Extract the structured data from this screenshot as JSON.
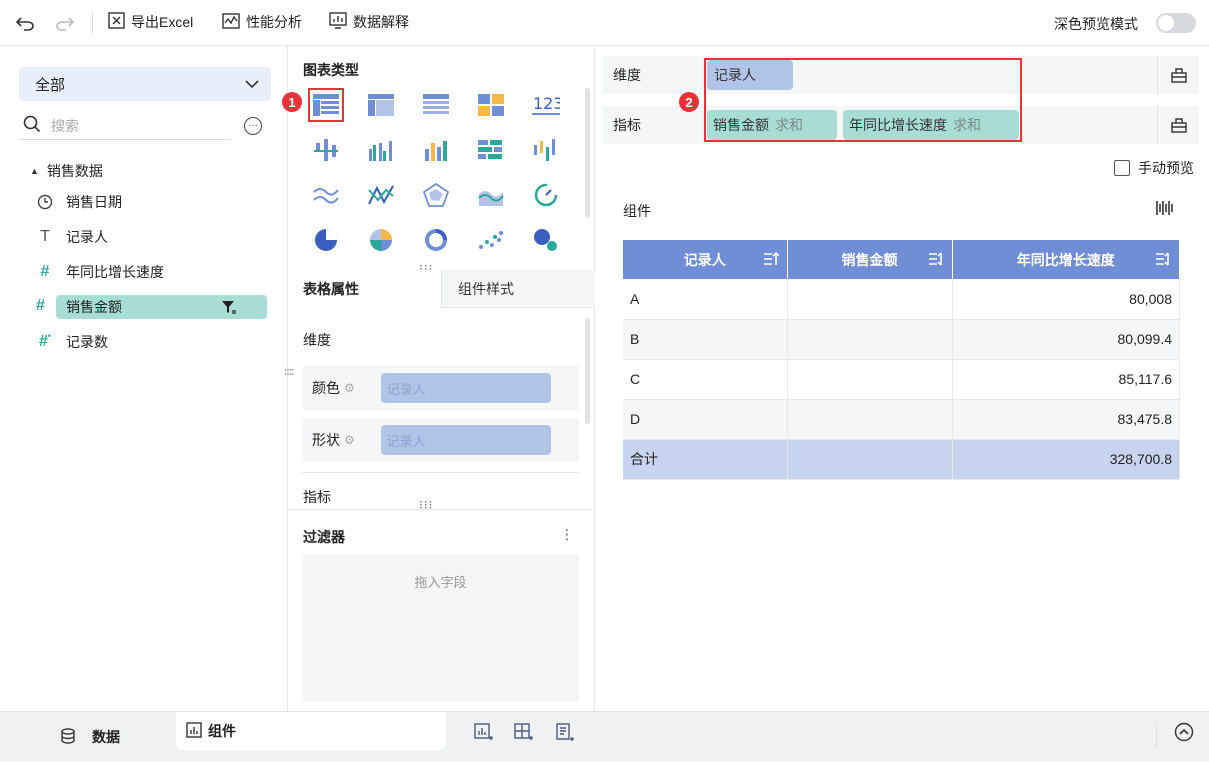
{
  "toolbar": {
    "export_label": "导出Excel",
    "perf_label": "性能分析",
    "explain_label": "数据解释",
    "dark_mode_label": "深色预览模式"
  },
  "left": {
    "select_value": "全部",
    "search_placeholder": "搜索",
    "dataset": "销售数据",
    "fields": [
      {
        "label": "销售日期",
        "icon": "clock-icon"
      },
      {
        "label": "记录人",
        "icon": "text-T-icon"
      },
      {
        "label": "年同比增长速度",
        "icon": "hash-icon"
      },
      {
        "label": "销售金额",
        "icon": "hash-icon"
      },
      {
        "label": "记录数",
        "icon": "hash-count-icon"
      }
    ]
  },
  "mid": {
    "chart_type_title": "图表类型",
    "tab_table_attr": "表格属性",
    "tab_component_style": "组件样式",
    "dimension_label": "维度",
    "color_label": "颜色",
    "color_value": "记录人",
    "shape_label": "形状",
    "shape_value": "记录人",
    "metric_label": "指标",
    "filter_title": "过滤器",
    "filter_drop_hint": "拖入字段"
  },
  "right": {
    "dimension_label": "维度",
    "dimension_pill": "记录人",
    "metric_label": "指标",
    "metric_pill_1": "销售金额",
    "metric_pill_1_agg": "求和",
    "metric_pill_2": "年同比增长速度",
    "metric_pill_2_agg": "求和",
    "manual_preview": "手动预览",
    "component_title": "组件",
    "badge_1": "1",
    "badge_2": "2"
  },
  "table": {
    "headers": [
      "记录人",
      "销售金额",
      "年同比增长速度"
    ],
    "rows": [
      [
        "A",
        "",
        "80,008"
      ],
      [
        "B",
        "",
        "80,099.4"
      ],
      [
        "C",
        "",
        "85,117.6"
      ],
      [
        "D",
        "",
        "83,475.8"
      ]
    ],
    "total": [
      "合计",
      "",
      "328,700.8"
    ]
  },
  "bottom": {
    "data_tab": "数据",
    "component_tab": "组件"
  },
  "colors": {
    "accent": "#6f8ed6",
    "dimension_pill": "#b2c3e8",
    "metric_pill": "#a8ddd5",
    "highlight": "#e8333a"
  }
}
